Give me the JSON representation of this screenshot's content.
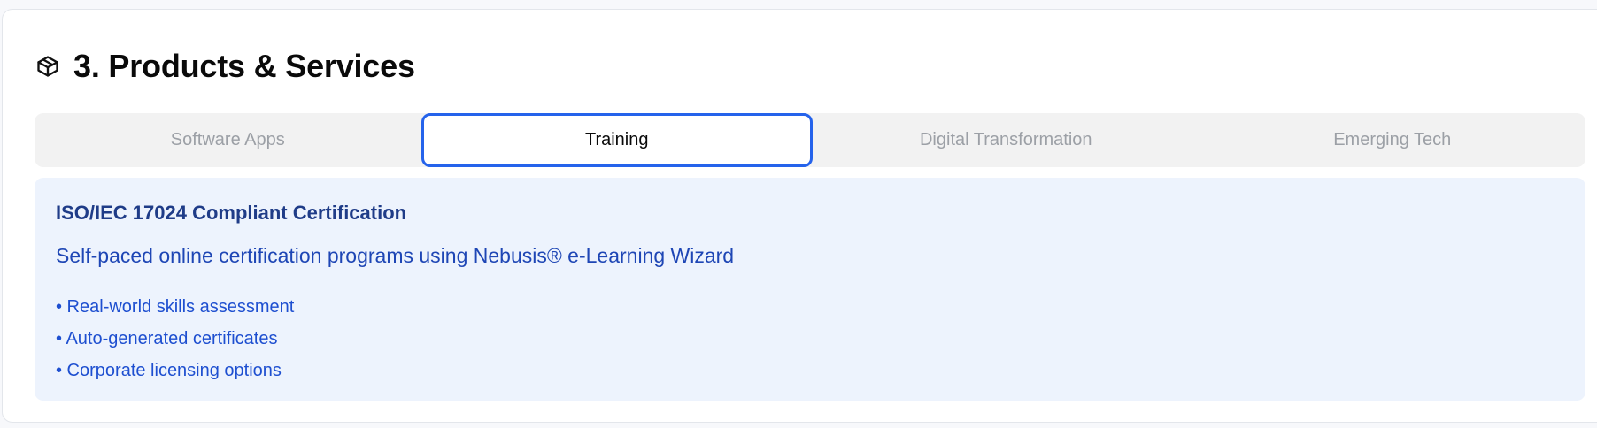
{
  "section": {
    "icon": "package-icon",
    "title": "3. Products & Services"
  },
  "tabs": [
    {
      "label": "Software Apps",
      "active": false
    },
    {
      "label": "Training",
      "active": true
    },
    {
      "label": "Digital Transformation",
      "active": false
    },
    {
      "label": "Emerging Tech",
      "active": false
    }
  ],
  "panel": {
    "title": "ISO/IEC 17024 Compliant Certification",
    "subtitle": "Self-paced online certification programs using Nebusis® e-Learning Wizard",
    "features": [
      "• Real-world skills assessment",
      "• Auto-generated certificates",
      "• Corporate licensing options"
    ]
  },
  "colors": {
    "accent": "#2563eb",
    "panel_bg": "#edf3fd",
    "panel_title": "#1f3c88",
    "panel_text": "#1e46b5"
  }
}
